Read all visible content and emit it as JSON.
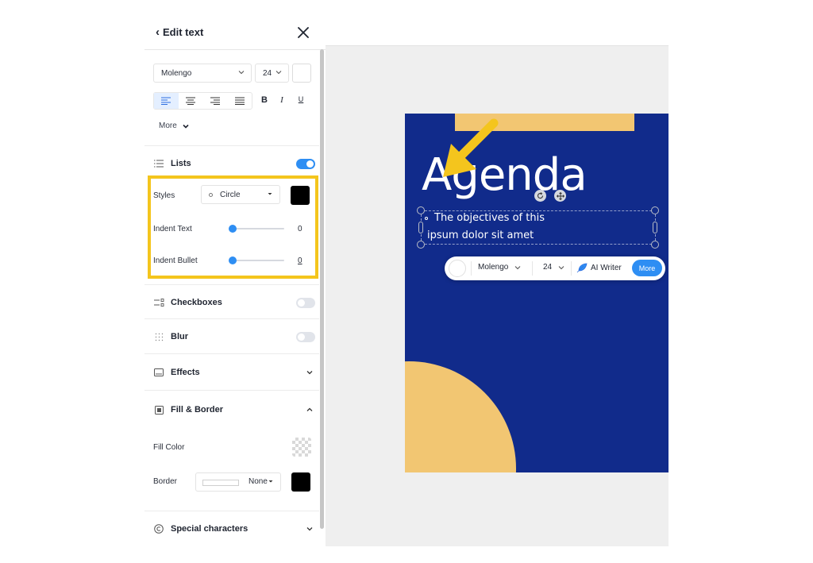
{
  "panel": {
    "back_label": "Edit text",
    "font_family": "Molengo",
    "font_size": "24",
    "text_color": "#ffffff",
    "bold_label": "B",
    "italic_label": "I",
    "underline_label": "U",
    "more_label": "More"
  },
  "lists": {
    "title": "Lists",
    "enabled": true,
    "styles_label": "Styles",
    "style_value": "Circle",
    "bullet_color": "#000000",
    "indent_text_label": "Indent Text",
    "indent_text_value": "0",
    "indent_bullet_label": "Indent Bullet",
    "indent_bullet_value": "0"
  },
  "sections": {
    "checkboxes": "Checkboxes",
    "blur": "Blur",
    "effects": "Effects",
    "fill_border": "Fill & Border",
    "special_chars": "Special characters"
  },
  "fill_border": {
    "fill_color_label": "Fill Color",
    "border_label": "Border",
    "border_style": "None",
    "border_color": "#000000"
  },
  "slide": {
    "title": "Agenda",
    "line1": "The objectives of this",
    "line2": "ipsum dolor sit amet",
    "background": "#112b8b",
    "accent": "#f2c672"
  },
  "float_toolbar": {
    "font_family": "Molengo",
    "font_size": "24",
    "ai_writer": "AI Writer",
    "more": "More"
  },
  "colors": {
    "accent_blue": "#2e8ef3",
    "highlight_yellow": "#f4c51d"
  }
}
